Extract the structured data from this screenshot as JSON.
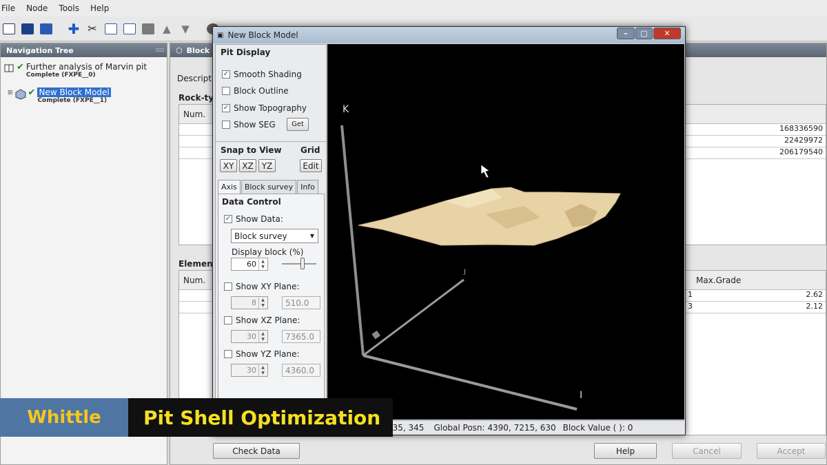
{
  "menu": {
    "items": [
      "File",
      "Node",
      "Tools",
      "Help"
    ]
  },
  "nav": {
    "title": "Navigation Tree",
    "nodes": [
      {
        "label": "Further analysis of Marvin pit",
        "status": "Complete (FXPE__0)"
      },
      {
        "label": "New Block Model",
        "status": "Complete (FXPE__1)"
      }
    ]
  },
  "main": {
    "tab_title": "Block",
    "description_label": "Description",
    "rocktypes": {
      "label": "Rock-typ",
      "col_num": "Num.",
      "values": [
        "168336590",
        "22429972",
        "206179540"
      ]
    },
    "elements": {
      "label": "Elements",
      "col_num": "Num.",
      "col_maxgrade": "Max.Grade",
      "rows": [
        {
          "num": "1",
          "max_grade": "2.62"
        },
        {
          "num": "3",
          "max_grade": "2.12"
        }
      ]
    },
    "buttons": {
      "check_data": "Check Data",
      "help": "Help",
      "cancel": "Cancel",
      "accept": "Accept"
    }
  },
  "dialog": {
    "title": "New Block Model",
    "pit_display": {
      "section": "Pit Display",
      "smooth_shading": {
        "label": "Smooth Shading",
        "checked": true
      },
      "block_outline": {
        "label": "Block Outline",
        "checked": false
      },
      "show_topography": {
        "label": "Show Topography",
        "checked": true
      },
      "show_seg": {
        "label": "Show SEG",
        "checked": false
      },
      "get_button": "Get"
    },
    "snap": {
      "label": "Snap to View",
      "xy": "XY",
      "xz": "XZ",
      "yz": "YZ"
    },
    "grid": {
      "label": "Grid",
      "edit": "Edit"
    },
    "tabs": [
      "Axis",
      "Block survey",
      "Info"
    ],
    "data_control": {
      "section": "Data Control",
      "show_data": {
        "label": "Show Data:",
        "checked": true
      },
      "data_source": "Block survey",
      "display_block_label": "Display block (%)",
      "display_block_value": "60",
      "display_block_fraction": 0.6,
      "xy_plane": {
        "label": "Show XY Plane:",
        "checked": false,
        "count": "8",
        "value": "510.0"
      },
      "xz_plane": {
        "label": "Show XZ Plane:",
        "checked": false,
        "count": "30",
        "value": "7365.0"
      },
      "yz_plane": {
        "label": "Show YZ Plane:",
        "checked": false,
        "count": "30",
        "value": "4360.0"
      }
    },
    "axes": {
      "k": "K",
      "i": "I",
      "j": "J"
    },
    "status": {
      "partial_coords": "735, 345",
      "global_posn": "Global Posn: 4390, 7215, 630",
      "block_value": "Block Value ( ): 0"
    }
  },
  "caption": {
    "left": "Whittle",
    "right": "Pit Shell Optimization"
  },
  "colors": {
    "surface": "#e8d3a6",
    "caption_yellow": "#f6e020",
    "caption_blue": "#4f76a3",
    "selection": "#2f6fd0"
  }
}
